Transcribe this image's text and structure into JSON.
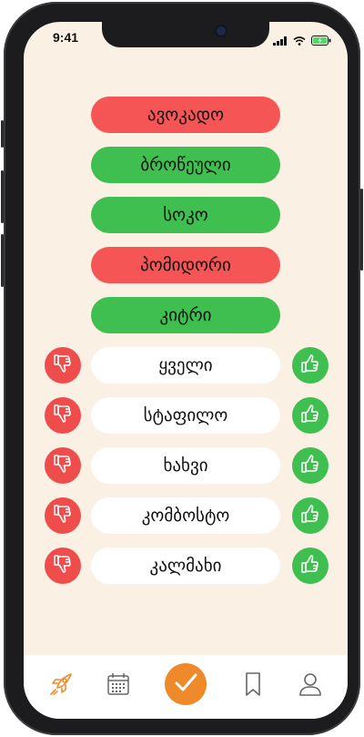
{
  "status": {
    "time": "9:41"
  },
  "decided": [
    {
      "label": "ავოკადო",
      "state": "disliked",
      "color": "#f55555"
    },
    {
      "label": "ბროწეული",
      "state": "liked",
      "color": "#3fbf50"
    },
    {
      "label": "სოკო",
      "state": "liked",
      "color": "#3fbf50"
    },
    {
      "label": "პომიდორი",
      "state": "disliked",
      "color": "#f55555"
    },
    {
      "label": "კიტრი",
      "state": "liked",
      "color": "#3fbf50"
    }
  ],
  "pending": [
    {
      "label": "ყველი"
    },
    {
      "label": "სტაფილო"
    },
    {
      "label": "ხახვი"
    },
    {
      "label": "კომბოსტო"
    },
    {
      "label": "კალმახი"
    }
  ],
  "tabbar": {
    "items": [
      "rocket-icon",
      "calendar-icon",
      "checkmark-icon",
      "bookmark-icon",
      "profile-icon"
    ],
    "active": "checkmark-icon",
    "accent": "#ee8a2a"
  },
  "colors": {
    "like": "#3fbf50",
    "dislike": "#ef4c4c",
    "background": "#fbf0e4"
  }
}
